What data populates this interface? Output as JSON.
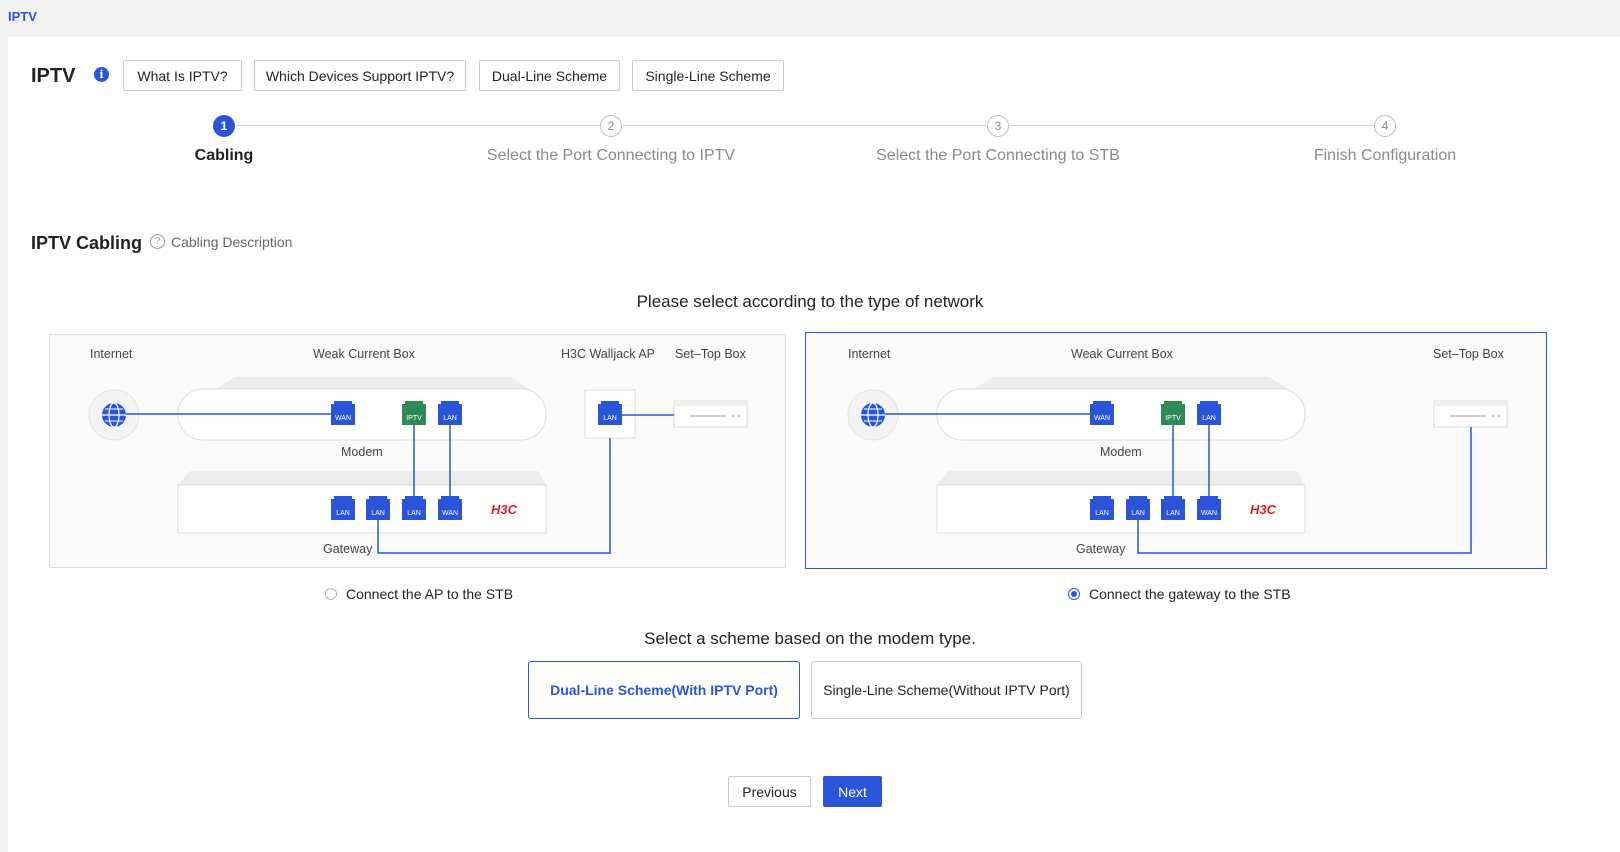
{
  "breadcrumb": "IPTV",
  "page_title": "IPTV",
  "top_buttons": [
    "What Is IPTV?",
    "Which Devices Support IPTV?",
    "Dual-Line Scheme",
    "Single-Line Scheme"
  ],
  "steps": [
    {
      "num": "1",
      "label": "Cabling",
      "active": true
    },
    {
      "num": "2",
      "label": "Select the Port Connecting to IPTV",
      "active": false
    },
    {
      "num": "3",
      "label": "Select the Port Connecting to STB",
      "active": false
    },
    {
      "num": "4",
      "label": "Finish Configuration",
      "active": false
    }
  ],
  "section": {
    "title": "IPTV Cabling",
    "description_link": "Cabling Description"
  },
  "network_prompt": "Please select according to the type of network",
  "diagrams": [
    {
      "labels": {
        "internet": "Internet",
        "weak_box": "Weak Current Box",
        "ap": "H3C Walljack AP",
        "stb": "Set–Top Box",
        "modem": "Modem",
        "gateway": "Gateway",
        "brand": "H3C"
      },
      "ports": {
        "wan": "WAN",
        "iptv": "IPTV",
        "lan": "LAN"
      },
      "option_label": "Connect the AP to the STB",
      "selected": false
    },
    {
      "labels": {
        "internet": "Internet",
        "weak_box": "Weak Current Box",
        "stb": "Set–Top Box",
        "modem": "Modem",
        "gateway": "Gateway",
        "brand": "H3C"
      },
      "ports": {
        "wan": "WAN",
        "iptv": "IPTV",
        "lan": "LAN"
      },
      "option_label": "Connect the gateway to the STB",
      "selected": true
    }
  ],
  "scheme_prompt": "Select a scheme based on the modem type.",
  "schemes": [
    {
      "label": "Dual-Line Scheme(With IPTV Port)",
      "selected": true
    },
    {
      "label": "Single-Line Scheme(Without IPTV Port)",
      "selected": false
    }
  ],
  "buttons": {
    "previous": "Previous",
    "next": "Next"
  },
  "colors": {
    "accent": "#2b55d8",
    "port_blue": "#2b55d8",
    "port_iptv": "#2e8b57",
    "brand_red": "#d81e2a"
  }
}
